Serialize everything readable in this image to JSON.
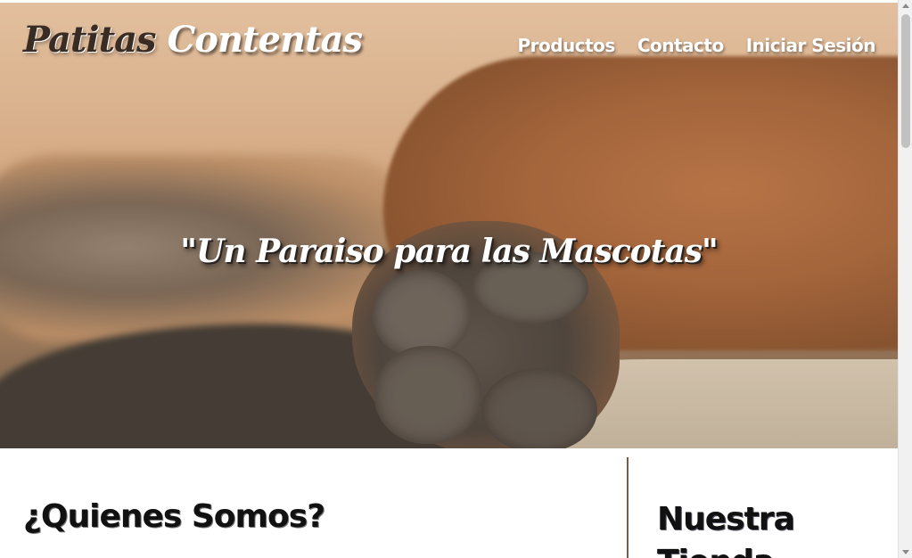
{
  "header": {
    "brand_part1": "Patitas",
    "brand_part2": "Contentas",
    "nav": [
      {
        "label": "Productos"
      },
      {
        "label": "Contacto"
      },
      {
        "label": "Iniciar Sesión"
      }
    ]
  },
  "hero": {
    "tagline": "\"Un Paraiso para las Mascotas\"",
    "image_subject": "dog-paw-photo"
  },
  "main": {
    "about_title": "¿Quienes Somos?",
    "store_title": "Nuestra Tienda"
  },
  "colors": {
    "brand_dark": "#3a2c22",
    "text_dark": "#111111",
    "divider": "#7a5a42",
    "nav_text": "#ffffff"
  }
}
